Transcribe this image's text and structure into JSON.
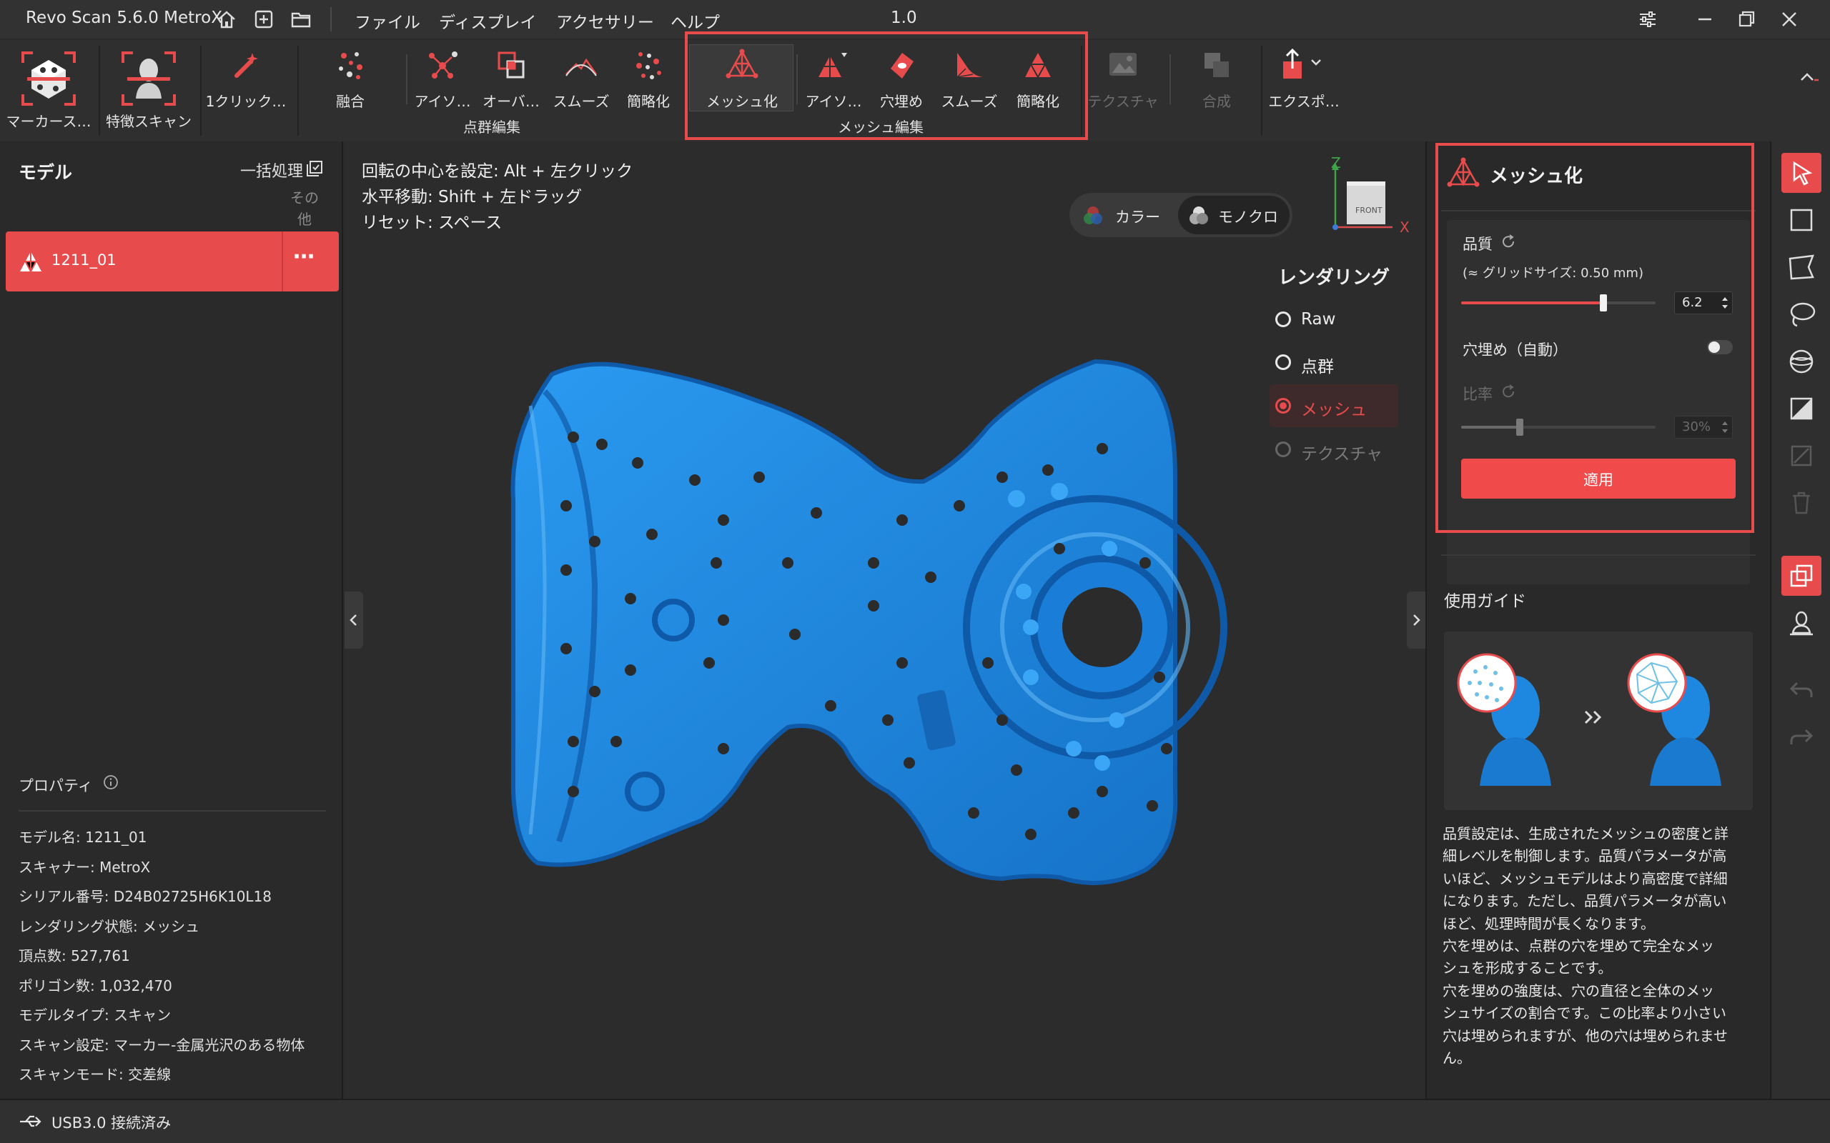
{
  "titlebar": {
    "app_title": "Revo Scan 5.6.0 MetroX",
    "menu": [
      "ファイル",
      "ディスプレイ",
      "アクセサリー",
      "ヘルプ"
    ],
    "version": "1.0"
  },
  "toolbar": {
    "tools": {
      "marker_scan": "マーカース…",
      "feature_scan": "特徴スキャン",
      "one_click": "1クリック…",
      "merge": "融合",
      "iso": "アイソ…",
      "overlap": "オーバ…",
      "smooth": "スムーズ",
      "simplify": "簡略化",
      "meshing": "メッシュ化",
      "mesh_iso": "アイソ…",
      "fill_holes": "穴埋め",
      "mesh_smooth": "スムーズ",
      "mesh_simplify": "簡略化",
      "texture": "テクスチャ",
      "compose": "合成",
      "export": "エクスポ…"
    },
    "groups": {
      "point_cloud_edit": "点群編集",
      "mesh_edit": "メッシュ編集"
    }
  },
  "left_panel": {
    "title": "モデル",
    "batch": "一括処理",
    "other": "その他",
    "model_item": "1211_01",
    "more": "⋯",
    "properties_title": "プロパティ",
    "properties": [
      {
        "label": "モデル名:",
        "value": "1211_01"
      },
      {
        "label": "スキャナー:",
        "value": "MetroX"
      },
      {
        "label": "シリアル番号:",
        "value": "D24B02725H6K10L18"
      },
      {
        "label": "レンダリング状態:",
        "value": "メッシュ"
      },
      {
        "label": "頂点数:",
        "value": "527,761"
      },
      {
        "label": "ポリゴン数:",
        "value": "1,032,470"
      },
      {
        "label": "モデルタイプ:",
        "value": "スキャン"
      },
      {
        "label": "スキャン設定:",
        "value": "マーカー-金属光沢のある物体"
      },
      {
        "label": "スキャンモード:",
        "value": "交差線"
      }
    ]
  },
  "viewport": {
    "hints": [
      "回転の中心を設定: Alt + 左クリック",
      "水平移動: Shift + 左ドラッグ",
      "リセット: スペース"
    ],
    "color_mode": {
      "color": "カラー",
      "mono": "モノクロ"
    },
    "axis": {
      "z": "Z",
      "x": "X",
      "front": "FRONT"
    },
    "rendering": {
      "title": "レンダリング",
      "options": [
        "Raw",
        "点群",
        "メッシュ",
        "テクスチャ"
      ],
      "selected": "メッシュ"
    },
    "colors": {
      "model": "#1e88e0",
      "accent": "#e84b4b"
    }
  },
  "right_panel": {
    "title": "メッシュ化",
    "quality_label": "品質",
    "grid_size": "(≈ グリッドサイズ: 0.50 mm)",
    "quality_value": "6.2",
    "quality_fraction": 0.73,
    "fill_holes_label": "穴埋め（自動）",
    "fill_holes_on": false,
    "ratio_label": "比率",
    "ratio_value": "30%",
    "ratio_fraction": 0.3,
    "apply": "適用",
    "guide_title": "使用ガイド",
    "guide_text": [
      "品質設定は、生成されたメッシュの密度と詳",
      "細レベルを制御します。品質パラメータが高",
      "いほど、メッシュモデルはより高密度で詳細",
      "になります。ただし、品質パラメータが高い",
      "ほど、処理時間が長くなります。",
      "穴を埋めは、点群の穴を埋めて完全なメッ",
      "シュを形成することです。",
      "穴を埋めの強度は、穴の直径と全体のメッ",
      "シュサイズの割合です。この比率より小さい",
      "穴は埋められますが、他の穴は埋められませ",
      "ん。"
    ]
  },
  "status": {
    "connection": "USB3.0 接続済み"
  }
}
